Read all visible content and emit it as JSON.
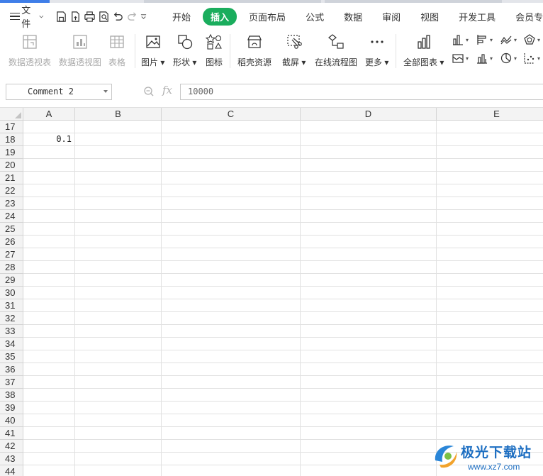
{
  "menubar": {
    "file_label": "文件",
    "tabs": [
      {
        "label": "开始",
        "active": false
      },
      {
        "label": "插入",
        "active": true
      },
      {
        "label": "页面布局",
        "active": false
      },
      {
        "label": "公式",
        "active": false
      },
      {
        "label": "数据",
        "active": false
      },
      {
        "label": "审阅",
        "active": false
      },
      {
        "label": "视图",
        "active": false
      },
      {
        "label": "开发工具",
        "active": false
      },
      {
        "label": "会员专",
        "active": false
      }
    ],
    "accent_color": "#1aad5d"
  },
  "ribbon": {
    "pivot_table": "数据透视表",
    "pivot_chart": "数据透视图",
    "table": "表格",
    "picture": "图片",
    "shape": "形状",
    "icon": "图标",
    "daoke": "稻壳资源",
    "screenshot": "截屏",
    "flowchart": "在线流程图",
    "more": "更多",
    "all_charts": "全部图表"
  },
  "formula_bar": {
    "name_box": "Comment 2",
    "fx_label": "fx",
    "value": "10000"
  },
  "sheet": {
    "columns": [
      "A",
      "B",
      "C",
      "D",
      "E"
    ],
    "rows": [
      "17",
      "18",
      "19",
      "20",
      "21",
      "22",
      "23",
      "24",
      "25",
      "26",
      "27",
      "28",
      "29",
      "30",
      "31",
      "32",
      "33",
      "34",
      "35",
      "36",
      "37",
      "38",
      "39",
      "40",
      "41",
      "42",
      "43",
      "44"
    ],
    "cells": {
      "A18": "0.1"
    }
  },
  "watermark": {
    "title": "极光下载站",
    "url": "www.xz7.com"
  }
}
